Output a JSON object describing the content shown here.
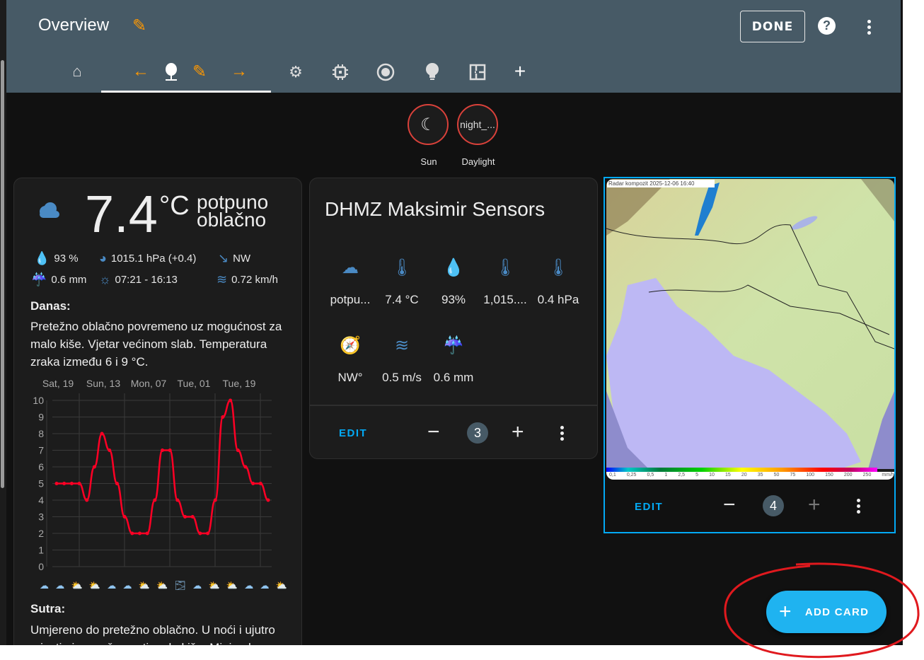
{
  "header": {
    "title": "Overview",
    "done_label": "DONE"
  },
  "tabs": [
    {
      "icon": "home-account-icon"
    },
    {
      "icon": "arrow-left-icon"
    },
    {
      "icon": "webcam-icon"
    },
    {
      "icon": "pencil-icon"
    },
    {
      "icon": "arrow-right-icon"
    },
    {
      "icon": "cog-sparkle-icon"
    },
    {
      "icon": "chip-icon"
    },
    {
      "icon": "robot-vacuum-icon"
    },
    {
      "icon": "lightbulb-icon"
    },
    {
      "icon": "floor-plan-icon"
    },
    {
      "icon": "plus-icon"
    }
  ],
  "badges": [
    {
      "label": "Sun",
      "value_icon": "weather-night-icon"
    },
    {
      "label": "Daylight",
      "value": "night_..."
    }
  ],
  "weather": {
    "temp": "7.4",
    "unit": "°C",
    "condition_line1": "potpuno",
    "condition_line2": "oblačno",
    "humidity": "93 %",
    "pressure": "1015.1 hPa (+0.4)",
    "wind_dir": "NW",
    "precip": "0.6 mm",
    "sun": "07:21 - 16:13",
    "wind_speed": "0.72 km/h",
    "today_label": "Danas:",
    "today_text": "Pretežno oblačno povremeno uz mogućnost za malo kiše. Vjetar većinom slab. Temperatura zraka između 6 i 9 °C.",
    "tomorrow_label": "Sutra:",
    "tomorrow_text": "Umjereno do pretežno oblačno. U noći i ujutro mjestimice može pasti malo kiše. Minimalna",
    "forecast_icons": [
      "night-cloudy",
      "cloudy",
      "partly-cloudy-rain",
      "partly-cloudy",
      "night-cloudy",
      "night-cloudy",
      "partly-cloudy-rain",
      "partly-cloudy-rain",
      "fog",
      "night-cloudy",
      "partly-cloudy",
      "partly-cloudy",
      "night-cloudy",
      "night-cloudy",
      "partly-cloudy"
    ]
  },
  "chart_data": {
    "type": "line",
    "x_tick_labels": [
      "Sat, 19",
      "Sun, 13",
      "Mon, 07",
      "Tue, 01",
      "Tue, 19"
    ],
    "y_ticks": [
      0,
      1,
      2,
      3,
      4,
      5,
      6,
      7,
      8,
      9,
      10
    ],
    "ylim": [
      0,
      10
    ],
    "series": [
      {
        "name": "temperature",
        "color": "#ff0025",
        "values": [
          5,
          5,
          5,
          5,
          4,
          6,
          8,
          7,
          5,
          3,
          2,
          2,
          2,
          4,
          7,
          7,
          4,
          3,
          3,
          2,
          2,
          4,
          9,
          10,
          7,
          6,
          5,
          5,
          4
        ]
      }
    ],
    "grid": true
  },
  "sensors": {
    "title": "DHMZ Maksimir Sensors",
    "items": [
      {
        "icon": "cloud-icon",
        "glyph": "☁",
        "value": "potpu..."
      },
      {
        "icon": "thermometer-icon",
        "glyph": "🌡",
        "value": "7.4 °C"
      },
      {
        "icon": "water-percent-icon",
        "glyph": "💧",
        "value": "93%"
      },
      {
        "icon": "thermometer-lines-icon",
        "glyph": "🌡",
        "value": "1,015...."
      },
      {
        "icon": "thermometer-plus-icon",
        "glyph": "🌡",
        "value": "0.4 hPa"
      },
      {
        "icon": "compass-icon",
        "glyph": "🧭",
        "value": "NW°"
      },
      {
        "icon": "weather-windy-icon",
        "glyph": "≋",
        "value": "0.5 m/s"
      },
      {
        "icon": "weather-pouring-icon",
        "glyph": "☔",
        "value": "0.6 mm"
      }
    ],
    "edit_label": "EDIT",
    "position": "3"
  },
  "radar": {
    "caption": "Radar kompozit  2025-12-06   16:40",
    "legend": [
      "0,1",
      "0,25",
      "0,5",
      "1",
      "2,5",
      "5",
      "10",
      "15",
      "20",
      "35",
      "50",
      "75",
      "100",
      "150",
      "200",
      "250",
      "mm/h"
    ],
    "edit_label": "EDIT",
    "position": "4"
  },
  "add_card_label": "ADD CARD",
  "colors": {
    "header": "#475a66",
    "accent": "#03a9f4",
    "orange": "#ff9800",
    "icon_blue": "#4a8ac4",
    "annotation_red": "#e0191e"
  }
}
